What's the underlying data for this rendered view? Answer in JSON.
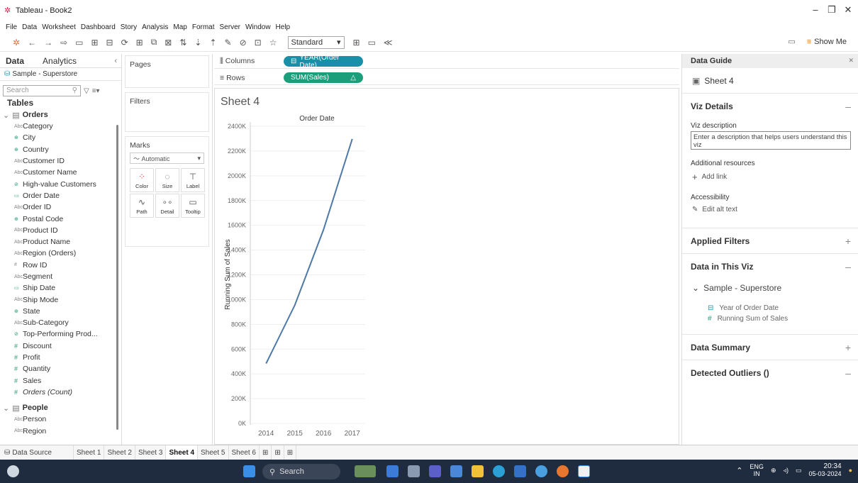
{
  "window": {
    "title": "Tableau - Book2"
  },
  "menu": [
    "File",
    "Data",
    "Worksheet",
    "Dashboard",
    "Story",
    "Analysis",
    "Map",
    "Format",
    "Server",
    "Window",
    "Help"
  ],
  "toolbar": {
    "fit_select": "Standard",
    "show_me": "Show Me"
  },
  "datapane": {
    "tab_data": "Data",
    "tab_analytics": "Analytics",
    "datasource": "Sample - Superstore",
    "search_placeholder": "Search",
    "tables_heading": "Tables",
    "group_orders": "Orders",
    "group_people": "People",
    "fields": [
      {
        "icon": "Abc",
        "label": "Category",
        "kind": "dim"
      },
      {
        "icon": "⊕",
        "label": "City",
        "kind": "geo"
      },
      {
        "icon": "⊕",
        "label": "Country",
        "kind": "geo"
      },
      {
        "icon": "Abc",
        "label": "Customer ID",
        "kind": "dim"
      },
      {
        "icon": "Abc",
        "label": "Customer Name",
        "kind": "dim"
      },
      {
        "icon": "⊘",
        "label": "High-value Customers",
        "kind": "set"
      },
      {
        "icon": "▭",
        "label": "Order Date",
        "kind": "date"
      },
      {
        "icon": "Abc",
        "label": "Order ID",
        "kind": "dim"
      },
      {
        "icon": "⊕",
        "label": "Postal Code",
        "kind": "geo"
      },
      {
        "icon": "Abc",
        "label": "Product ID",
        "kind": "dim"
      },
      {
        "icon": "Abc",
        "label": "Product Name",
        "kind": "dim"
      },
      {
        "icon": "Abc",
        "label": "Region (Orders)",
        "kind": "dim"
      },
      {
        "icon": "#",
        "label": "Row ID",
        "kind": "dim"
      },
      {
        "icon": "Abc",
        "label": "Segment",
        "kind": "dim"
      },
      {
        "icon": "▭",
        "label": "Ship Date",
        "kind": "date"
      },
      {
        "icon": "Abc",
        "label": "Ship Mode",
        "kind": "dim"
      },
      {
        "icon": "⊕",
        "label": "State",
        "kind": "geo"
      },
      {
        "icon": "Abc",
        "label": "Sub-Category",
        "kind": "dim"
      },
      {
        "icon": "⊘",
        "label": "Top-Performing Prod...",
        "kind": "set"
      },
      {
        "icon": "#",
        "label": "Discount",
        "kind": "meas"
      },
      {
        "icon": "#",
        "label": "Profit",
        "kind": "meas"
      },
      {
        "icon": "#",
        "label": "Quantity",
        "kind": "meas"
      },
      {
        "icon": "#",
        "label": "Sales",
        "kind": "meas"
      },
      {
        "icon": "#",
        "label": "Orders (Count)",
        "kind": "meas-italic"
      }
    ],
    "people_fields": [
      {
        "icon": "Abc",
        "label": "Person"
      },
      {
        "icon": "Abc",
        "label": "Region"
      }
    ]
  },
  "shelves": {
    "pages": "Pages",
    "filters": "Filters",
    "marks": "Marks",
    "mark_type": "Automatic",
    "mark_buttons": [
      "Color",
      "Size",
      "Label",
      "Path",
      "Detail",
      "Tooltip"
    ],
    "columns_label": "Columns",
    "rows_label": "Rows",
    "columns_pill": "YEAR(Order Date)",
    "rows_pill": "SUM(Sales)"
  },
  "sheet": {
    "title": "Sheet 4"
  },
  "chart_data": {
    "type": "line",
    "title": "Order Date",
    "ylabel": "Running Sum of Sales",
    "xlabel": "",
    "x": [
      "2014",
      "2015",
      "2016",
      "2017"
    ],
    "values": [
      484,
      955,
      1565,
      2297
    ],
    "yticks": [
      "0K",
      "200K",
      "400K",
      "600K",
      "800K",
      "1000K",
      "1200K",
      "1400K",
      "1600K",
      "1800K",
      "2000K",
      "2200K",
      "2400K"
    ],
    "ylim": [
      0,
      2400
    ],
    "line_color": "#4e79a7"
  },
  "guide": {
    "heading": "Data Guide",
    "sheet_name": "Sheet 4",
    "viz_details": "Viz Details",
    "viz_description_label": "Viz description",
    "viz_description_placeholder": "Enter a description that helps users understand this viz",
    "additional_resources": "Additional resources",
    "add_link": "Add link",
    "accessibility": "Accessibility",
    "edit_alt_text": "Edit alt text",
    "applied_filters": "Applied Filters",
    "data_in_viz": "Data in This Viz",
    "source": "Sample - Superstore",
    "viz_fields": [
      "Year of Order Date",
      "Running Sum of Sales"
    ],
    "data_summary": "Data Summary",
    "detected_outliers": "Detected Outliers ()"
  },
  "sheettabs": {
    "datasource": "Data Source",
    "tabs": [
      "Sheet 1",
      "Sheet 2",
      "Sheet 3",
      "Sheet 4",
      "Sheet 5",
      "Sheet 6"
    ],
    "active": "Sheet 4"
  },
  "taskbar": {
    "search": "Search",
    "lang_top": "ENG",
    "lang_bottom": "IN",
    "time": "20:34",
    "date": "05-03-2024"
  }
}
